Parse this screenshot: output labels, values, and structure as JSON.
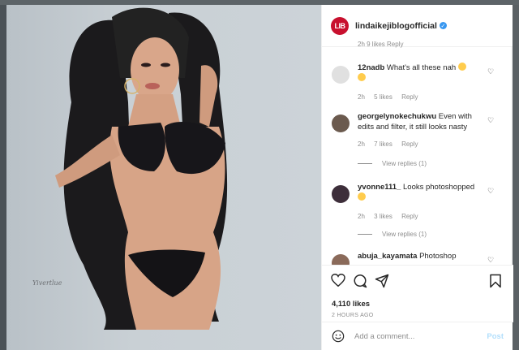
{
  "post": {
    "username": "lindaikejiblogofficial",
    "avatar_text": "LIB",
    "watermark": "Yivertlue",
    "likes": "4,110 likes",
    "time": "2 HOURS AGO"
  },
  "partial_top_meta": "2h   9 likes   Reply",
  "comments": [
    {
      "user": "12nadb",
      "text": "What's all these nah",
      "time": "2h",
      "likes": "5 likes",
      "reply": "Reply",
      "avatar_color": "#dbdbdb"
    },
    {
      "user": "georgelynokechukwu",
      "text": "Even with edits and filter, it still looks nasty",
      "time": "2h",
      "likes": "7 likes",
      "reply": "Reply",
      "view_replies": "View replies (1)",
      "avatar_color": "#6b5a4e"
    },
    {
      "user": "yvonne111_",
      "text": "Looks photoshopped",
      "time": "2h",
      "likes": "3 likes",
      "reply": "Reply",
      "view_replies": "View replies (1)",
      "avatar_color": "#3d2e3a"
    },
    {
      "user": "abuja_kayamata",
      "text": "Photoshop",
      "avatar_color": "#8a6a5a"
    }
  ],
  "add_comment": {
    "placeholder": "Add a comment...",
    "post_label": "Post"
  },
  "colors": {
    "accent": "#3897f0",
    "brand_red": "#c8102e",
    "post_disabled": "#b2dffc"
  }
}
